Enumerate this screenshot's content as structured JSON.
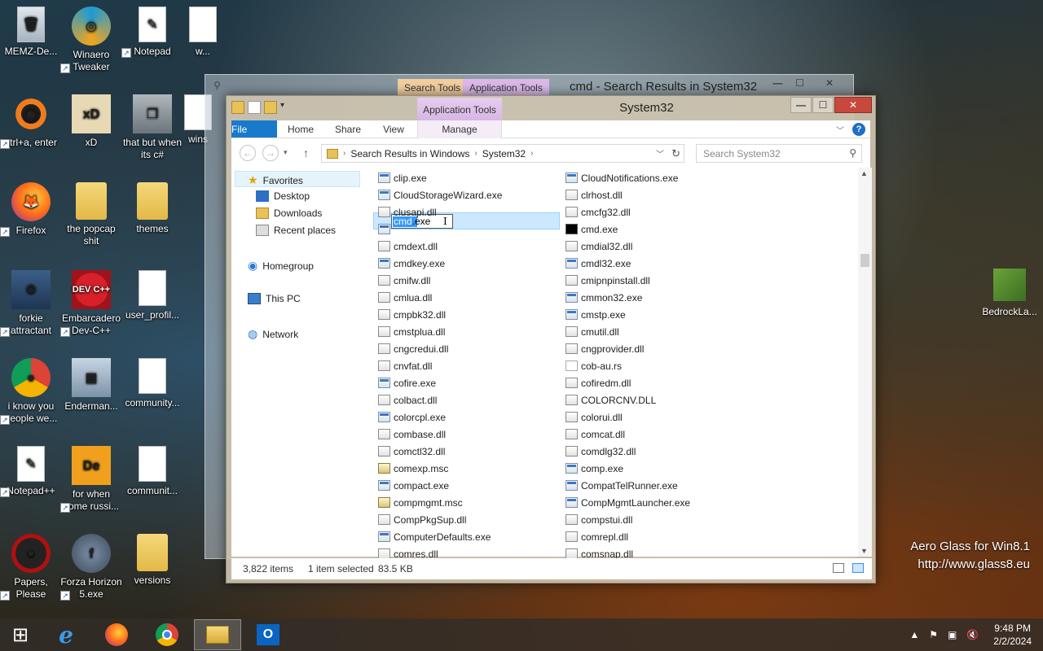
{
  "desktop": {
    "icons": [
      {
        "label": "MEMZ-De...",
        "glyph": "🗑"
      },
      {
        "label": "Winaero Tweaker",
        "glyph": "◎"
      },
      {
        "label": "Notepad",
        "glyph": "✎"
      },
      {
        "label": "w...",
        "glyph": ""
      },
      {
        "label": "ctrl+a, enter",
        "glyph": "◯"
      },
      {
        "label": "xD",
        "glyph": "xD"
      },
      {
        "label": "that but when its c#",
        "glyph": "❐"
      },
      {
        "label": "wins",
        "glyph": ""
      },
      {
        "label": "Firefox",
        "glyph": "🦊"
      },
      {
        "label": "the popcap shit",
        "glyph": ""
      },
      {
        "label": "themes",
        "glyph": ""
      },
      {
        "label": "forkie attractant",
        "glyph": "⚙"
      },
      {
        "label": "Embarcadero Dev-C++",
        "glyph": "DEV C++"
      },
      {
        "label": "user_profil...",
        "glyph": ""
      },
      {
        "label": "i know you people we...",
        "glyph": "●"
      },
      {
        "label": "Enderman...",
        "glyph": "▦"
      },
      {
        "label": "community...",
        "glyph": ""
      },
      {
        "label": "Notepad++",
        "glyph": "✎"
      },
      {
        "label": "for when some russi...",
        "glyph": "De"
      },
      {
        "label": "communit...",
        "glyph": ""
      },
      {
        "label": "Papers, Please",
        "glyph": "●"
      },
      {
        "label": "Forza Horizon 5.exe",
        "glyph": "f"
      },
      {
        "label": "versions",
        "glyph": ""
      }
    ],
    "right_icon": {
      "label": "BedrockLa..."
    },
    "watermark": {
      "line1": "Aero Glass for Win8.1",
      "line2": "http://www.glass8.eu"
    }
  },
  "back_window": {
    "search_tools": "Search Tools",
    "application_tools": "Application Tools",
    "title": "cmd - Search Results in System32",
    "colors": {
      "search_tools": "#f3cfa0",
      "application_tools": "#dcb9ea"
    }
  },
  "window": {
    "title": "System32",
    "context_tab": "Application Tools",
    "buttons": {
      "minimize": "—",
      "maximize": "☐",
      "close": "✕"
    },
    "ribbon_tabs": [
      {
        "label": "File"
      },
      {
        "label": "Home"
      },
      {
        "label": "Share"
      },
      {
        "label": "View"
      },
      {
        "label": "Manage"
      }
    ],
    "address": {
      "segments": [
        "Search Results in Windows",
        "System32"
      ],
      "search_placeholder": "Search System32"
    },
    "nav_pane": {
      "favorites": "Favorites",
      "desktop": "Desktop",
      "downloads": "Downloads",
      "recent": "Recent places",
      "homegroup": "Homegroup",
      "this_pc": "This PC",
      "network": "Network"
    },
    "rename": {
      "selected_part": "cmd",
      "rest": ".exe"
    },
    "files_col1": [
      {
        "name": "clip.exe",
        "icon": "exe"
      },
      {
        "name": "CloudStorageWizard.exe",
        "icon": "exe"
      },
      {
        "name": "clusapi.dll",
        "icon": "dll"
      },
      {
        "name": "",
        "icon": "exe"
      },
      {
        "name": "cmdext.dll",
        "icon": "dll"
      },
      {
        "name": "cmdkey.exe",
        "icon": "exe"
      },
      {
        "name": "cmifw.dll",
        "icon": "dll"
      },
      {
        "name": "cmlua.dll",
        "icon": "dll"
      },
      {
        "name": "cmpbk32.dll",
        "icon": "dll"
      },
      {
        "name": "cmstplua.dll",
        "icon": "dll"
      },
      {
        "name": "cngcredui.dll",
        "icon": "dll"
      },
      {
        "name": "cnvfat.dll",
        "icon": "dll"
      },
      {
        "name": "cofire.exe",
        "icon": "exe"
      },
      {
        "name": "colbact.dll",
        "icon": "dll"
      },
      {
        "name": "colorcpl.exe",
        "icon": "exe"
      },
      {
        "name": "combase.dll",
        "icon": "dll"
      },
      {
        "name": "comctl32.dll",
        "icon": "dll"
      },
      {
        "name": "comexp.msc",
        "icon": "msc"
      },
      {
        "name": "compact.exe",
        "icon": "exe"
      },
      {
        "name": "compmgmt.msc",
        "icon": "msc"
      },
      {
        "name": "CompPkgSup.dll",
        "icon": "dll"
      },
      {
        "name": "ComputerDefaults.exe",
        "icon": "exe"
      },
      {
        "name": "comres.dll",
        "icon": "dll"
      }
    ],
    "files_col2": [
      {
        "name": "CloudNotifications.exe",
        "icon": "exe"
      },
      {
        "name": "clrhost.dll",
        "icon": "dll"
      },
      {
        "name": "cmcfg32.dll",
        "icon": "dll"
      },
      {
        "name": "cmd.exe",
        "icon": "cmd"
      },
      {
        "name": "cmdial32.dll",
        "icon": "dll"
      },
      {
        "name": "cmdl32.exe",
        "icon": "exe"
      },
      {
        "name": "cmipnpinstall.dll",
        "icon": "dll"
      },
      {
        "name": "cmmon32.exe",
        "icon": "exe"
      },
      {
        "name": "cmstp.exe",
        "icon": "exe"
      },
      {
        "name": "cmutil.dll",
        "icon": "dll"
      },
      {
        "name": "cngprovider.dll",
        "icon": "dll"
      },
      {
        "name": "cob-au.rs",
        "icon": "blank"
      },
      {
        "name": "cofiredm.dll",
        "icon": "dll"
      },
      {
        "name": "COLORCNV.DLL",
        "icon": "dll"
      },
      {
        "name": "colorui.dll",
        "icon": "dll"
      },
      {
        "name": "comcat.dll",
        "icon": "dll"
      },
      {
        "name": "comdlg32.dll",
        "icon": "dll"
      },
      {
        "name": "comp.exe",
        "icon": "exe"
      },
      {
        "name": "CompatTelRunner.exe",
        "icon": "exe"
      },
      {
        "name": "CompMgmtLauncher.exe",
        "icon": "exe"
      },
      {
        "name": "compstui.dll",
        "icon": "dll"
      },
      {
        "name": "comrepl.dll",
        "icon": "dll"
      },
      {
        "name": "comsnap.dll",
        "icon": "dll"
      }
    ],
    "status": {
      "items": "3,822 items",
      "selected": "1 item selected",
      "size": "83.5 KB"
    }
  },
  "taskbar": {
    "items": [
      {
        "name": "start-button",
        "glyph": "⊞"
      },
      {
        "name": "internet-explorer",
        "glyph": "e"
      },
      {
        "name": "firefox",
        "glyph": "●"
      },
      {
        "name": "chrome",
        "glyph": "●"
      },
      {
        "name": "file-explorer",
        "glyph": "▤"
      },
      {
        "name": "outlook",
        "glyph": "O"
      }
    ],
    "clock": {
      "time": "9:48 PM",
      "date": "2/2/2024"
    }
  }
}
